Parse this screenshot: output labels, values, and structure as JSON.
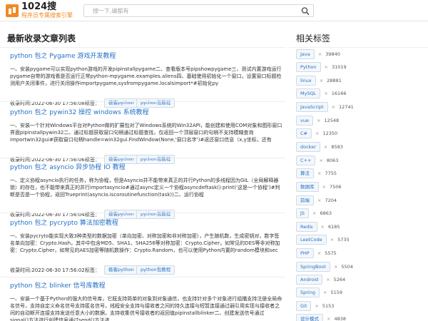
{
  "header": {
    "title": "1024搜",
    "subtitle": "程序员专属搜索引擎",
    "search_placeholder": "搜一下,编都有"
  },
  "main": {
    "title": "最新收录文章列表",
    "time_prefix": "收录时间:",
    "tags_label": "标签：",
    "articles": [
      {
        "title": "python 包之 Pygame 游戏开发教程",
        "body": "一、安装pygame可以实现python游戏的开发pipinstallpygame二、查看版本号pipshowpygame三、测试内置游戏运行pygame自带的游戏看是否运行正常python-mpygame.examples.aliens四、基础使用初始化一个窗口，设置窗口标题检测用户关闭事件，进行关闭操作importpygame,sysfrompygame.localsimport*#初始化py",
        "time": "2022-06-30 17:56:08",
        "tags": [
          "极客python",
          "python包教程"
        ]
      },
      {
        "title": "python 包之 pywin32 操控 windows 系统教程",
        "body": "一、安装一个针对Windows平台对Python做的扩展包对了Windows系统的Win32API，能创建和使用COM对象和图形窗口界面pipinstallpywin32二、通过标题获取窗口句柄通过标题查找，仅返回一个顶层窗口的句柄不支持模糊查询importwin32gui#获取窗口句柄handle=win32gui.FindWindow(None,'窗口名字')#返还窗口信息（x,y坐标，还有",
        "time": "2022-06-30 17:56:06",
        "tags": [
          "极客python",
          "python包教程"
        ]
      },
      {
        "title": "python 包之 asyncio 异步协程 IO 教程",
        "body": "一、定义协程asyncio执行的任务，称为协程，但是Asyncio并不能带来真正的并行Python的多线程因为GIL（全局解释器锁）的存在，也不能带来真正的并行importasyncio#通过async定义一个协程asyncdeftask():print('这是一个协程')#判断是否是一个协程，返回Trueprint(asyncio.iscoroutinefunction(task))二、运行协程",
        "time": "2022-06-30 17:56:04",
        "tags": [
          "极客python",
          "python包教程"
        ]
      },
      {
        "title": "python 包之 pycrypto 算法加密教程",
        "body": "一、安装pycryto能实现大致3种类型的数据加密（单向加密、对称加密和非对称加密），产生随机数，生成密钥对，数字签名单向加密：Crypto.Hash，其中中包含MD5、SHA1、SHA256等对称加密：Crypto.Cipher，如常见的DES等非对称加密：Crypto.Cipher，如常见的AES加密等随机数操作：Crypto.Random，也可以使用Python内置的random模块和sec",
        "time": "2022-06-30 17:56:02",
        "tags": [
          "极客python",
          "python包教程"
        ]
      },
      {
        "title": "python 包之 blinker 信号库教程",
        "body": "一、安装一个基于Python的强大的信号库，它既支持简单的对象到对象通信，也支持针对多个对象进行组播支持注册全局命名信号，支持自定义命名信号支持匿名信号，线程安全支持与接收者之间的持久连接与短暂连接通过弱引用实现与接收者之间的自动断开连接支持发送任意大小的数据，支持收集信号接收者的返回值pipinstallblinker二、创建发送信号通过signal()方法进行创建信号通过send()方法进",
        "time": "",
        "tags": []
      }
    ]
  },
  "sidebar": {
    "title": "相关标签",
    "tags": [
      {
        "name": "Java",
        "count": "39840"
      },
      {
        "name": "Python",
        "count": "31019"
      },
      {
        "name": "linux",
        "count": "28881"
      },
      {
        "name": "MySQL",
        "count": "16166"
      },
      {
        "name": "JavaScript",
        "count": "12741"
      },
      {
        "name": "vue",
        "count": "12548"
      },
      {
        "name": "C#",
        "count": "12350"
      },
      {
        "name": "docker",
        "count": "8583"
      },
      {
        "name": "C++",
        "count": "8063"
      },
      {
        "name": "算法",
        "count": "7755"
      },
      {
        "name": "数据库",
        "count": "7506"
      },
      {
        "name": "前端",
        "count": "7204"
      },
      {
        "name": "JS",
        "count": "6863"
      },
      {
        "name": "Redis",
        "count": "6185"
      },
      {
        "name": "LeetCode",
        "count": "5735"
      },
      {
        "name": "PHP",
        "count": "5575"
      },
      {
        "name": "SpringBoot",
        "count": "5504"
      },
      {
        "name": "Android",
        "count": "5264"
      },
      {
        "name": "Spring",
        "count": "5159"
      },
      {
        "name": "Git",
        "count": "5153"
      },
      {
        "name": "设计模式",
        "count": "4838"
      }
    ]
  },
  "colors": {
    "brand": "#f08a24",
    "link": "#2670c6",
    "tag_bg": "#f3f7fb",
    "tag_border": "#cfdbe6"
  }
}
